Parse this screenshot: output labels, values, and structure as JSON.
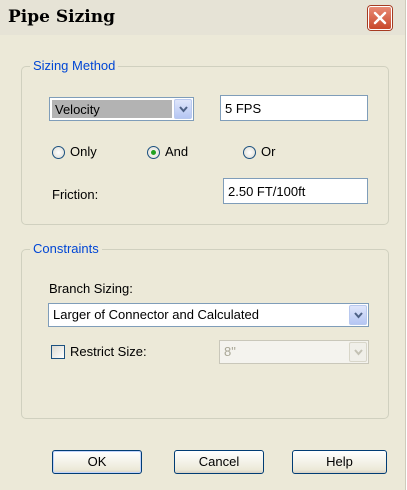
{
  "window": {
    "title": "Pipe Sizing"
  },
  "sizing_method": {
    "group_label": "Sizing Method",
    "method_select": "Velocity",
    "velocity_value": "5 FPS",
    "options": [
      "Only",
      "And",
      "Or"
    ],
    "selected_option": "And",
    "friction_label": "Friction:",
    "friction_value": "2.50 FT/100ft"
  },
  "constraints": {
    "group_label": "Constraints",
    "branch_sizing_label": "Branch Sizing:",
    "branch_sizing_select": "Larger of Connector and Calculated",
    "restrict_size_label": "Restrict Size:",
    "restrict_size_checked": false,
    "restrict_size_select": "8\"",
    "restrict_size_enabled": false
  },
  "buttons": {
    "ok": "OK",
    "cancel": "Cancel",
    "help": "Help"
  }
}
